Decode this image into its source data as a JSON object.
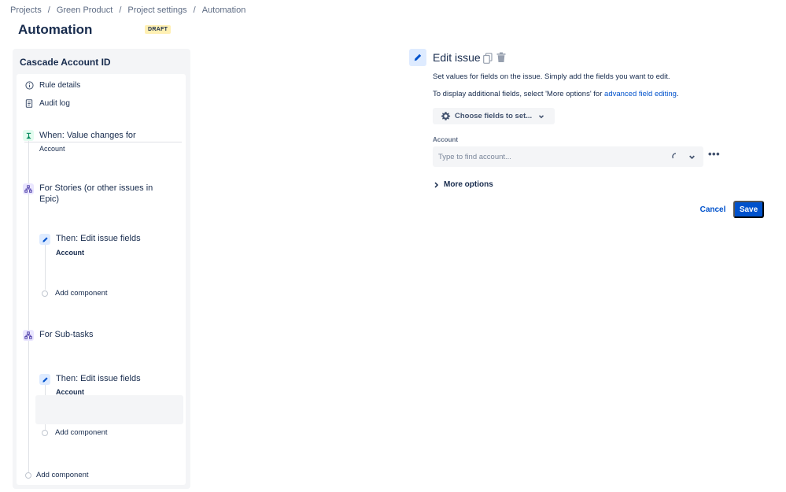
{
  "breadcrumb": {
    "items": [
      "Projects",
      "Green Product",
      "Project settings",
      "Automation"
    ],
    "separator": "/"
  },
  "page": {
    "title": "Automation",
    "badge": "DRAFT"
  },
  "rule": {
    "name": "Cascade Account ID",
    "menu": [
      {
        "label": "Rule details",
        "icon": "info-icon"
      },
      {
        "label": "Audit log",
        "icon": "document-icon"
      }
    ],
    "trigger": {
      "title": "When: Value changes for",
      "subtitle": "Account",
      "icon": "value-change-icon"
    },
    "branch1": {
      "title": "For Stories (or other issues in Epic)",
      "icon": "branch-icon"
    },
    "action1": {
      "title": "Then: Edit issue fields",
      "subtitle": "Account",
      "icon": "pencil-icon"
    },
    "branch2": {
      "title": "For Sub-tasks",
      "icon": "branch-icon"
    },
    "action2": {
      "title": "Then: Edit issue fields",
      "subtitle": "Account",
      "icon": "pencil-icon"
    },
    "add_component_label": "Add component"
  },
  "editor": {
    "title": "Edit issue",
    "description": "Set values for fields on the issue. Simply add the fields you want to edit.",
    "more_fields_text": "To display additional fields, select 'More options' for",
    "more_fields_link": "advanced field editing",
    "more_fields_suffix": ".",
    "choose_fields_label": "Choose fields to set...",
    "account_field": {
      "label": "Account",
      "placeholder": "Type to find account...",
      "value": ""
    },
    "more_options_label": "More options",
    "cancel_label": "Cancel",
    "save_label": "Save"
  },
  "colors": {
    "accent": "#0052cc",
    "badge_bg": "#fff0b3",
    "trigger_bg": "#e3fcef",
    "branch_bg": "#eae6ff",
    "action_bg": "#deebff"
  }
}
